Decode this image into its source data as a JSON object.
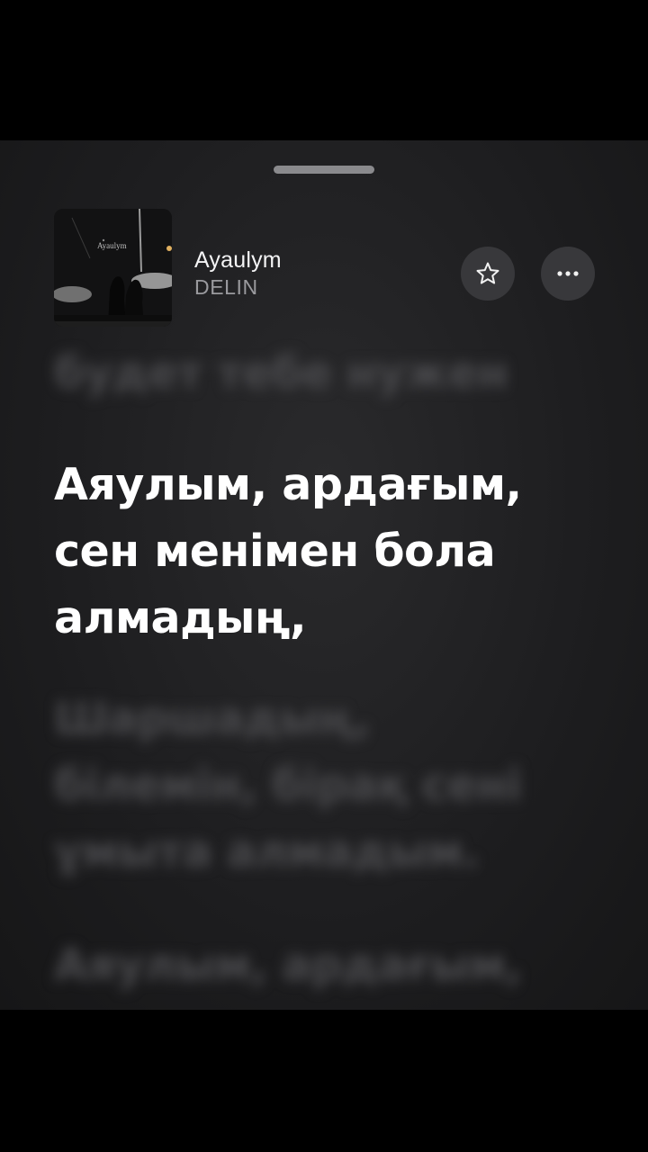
{
  "now_playing": {
    "title": "Ayaulym",
    "artist": "DELIN",
    "artwork_text": "Ayaulym"
  },
  "lyrics": {
    "previous": "будет тебе нужен",
    "active": [
      "Аяулым, ардағым,",
      "сен менімен бола",
      "алмадың,"
    ],
    "next": [
      "Шаршадың,",
      "білемін, бірақ сені",
      "ұмыта алмадым."
    ],
    "after": "Аяулым, ардағым,"
  },
  "icons": {
    "star": "star-icon",
    "more": "ellipsis-icon"
  },
  "colors": {
    "background": "#1d1d1f",
    "active_lyric": "#ffffff",
    "inactive_lyric": "#4a4a4d",
    "button_bg": "#38383b"
  }
}
